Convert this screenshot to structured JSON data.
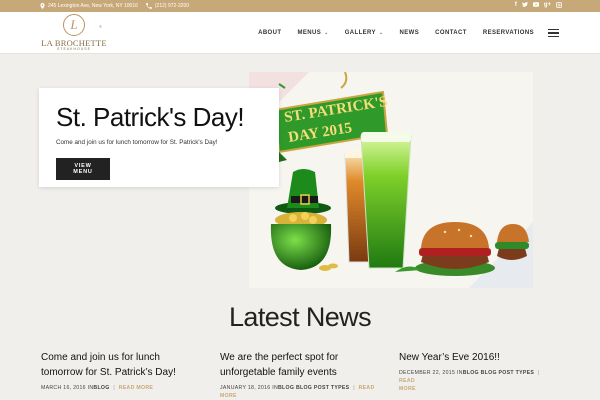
{
  "topbar": {
    "address": "245 Lexington Ave, New York, NY 10016",
    "phone": "(212) 972-3200",
    "socials": [
      "f",
      "t",
      "yt",
      "g+",
      "ig"
    ]
  },
  "logo": {
    "monogram": "L",
    "name": "LA BROCHETTE",
    "tagline": "STEAKHOUSE",
    "registered": "®"
  },
  "nav": {
    "items": [
      {
        "label": "ABOUT",
        "dropdown": false
      },
      {
        "label": "MENUS",
        "dropdown": true
      },
      {
        "label": "GALLERY",
        "dropdown": true
      },
      {
        "label": "NEWS",
        "dropdown": false
      },
      {
        "label": "CONTACT",
        "dropdown": false
      },
      {
        "label": "RESERVATIONS",
        "dropdown": false
      }
    ],
    "caret": "⌄"
  },
  "hero": {
    "title": "St. Patrick's Day!",
    "text": "Come and join us for lunch tomorrow for St. Patrick's Day!",
    "button": "VIEW MENU",
    "banner_line1": "ST. PATRICK'S",
    "banner_line2": "DAY 2015"
  },
  "news": {
    "heading": "Latest News",
    "read_more": "READ MORE",
    "posts": [
      {
        "title": "Come and join us for lunch tomorrow for St. Patrick’s Day!",
        "date": "MARCH 16, 2016",
        "prefix": "IN",
        "categories": "BLOG",
        "more_inline": "READ MORE"
      },
      {
        "title": "We are the perfect spot for unforgetable family events",
        "date": "JANUARY 18, 2016",
        "prefix": "IN",
        "categories": "BLOG BLOG POST TYPES",
        "more_inline": "READ"
      },
      {
        "title": "New Year’s Eve 2016!!",
        "date": "DECEMBER 22, 2015",
        "prefix": "IN",
        "categories": "BLOG BLOG POST TYPES",
        "more_inline": "READ"
      }
    ],
    "more_wrap": "MORE"
  },
  "colors": {
    "accent": "#c7a878",
    "dark": "#222222",
    "background": "#f1efeb"
  }
}
